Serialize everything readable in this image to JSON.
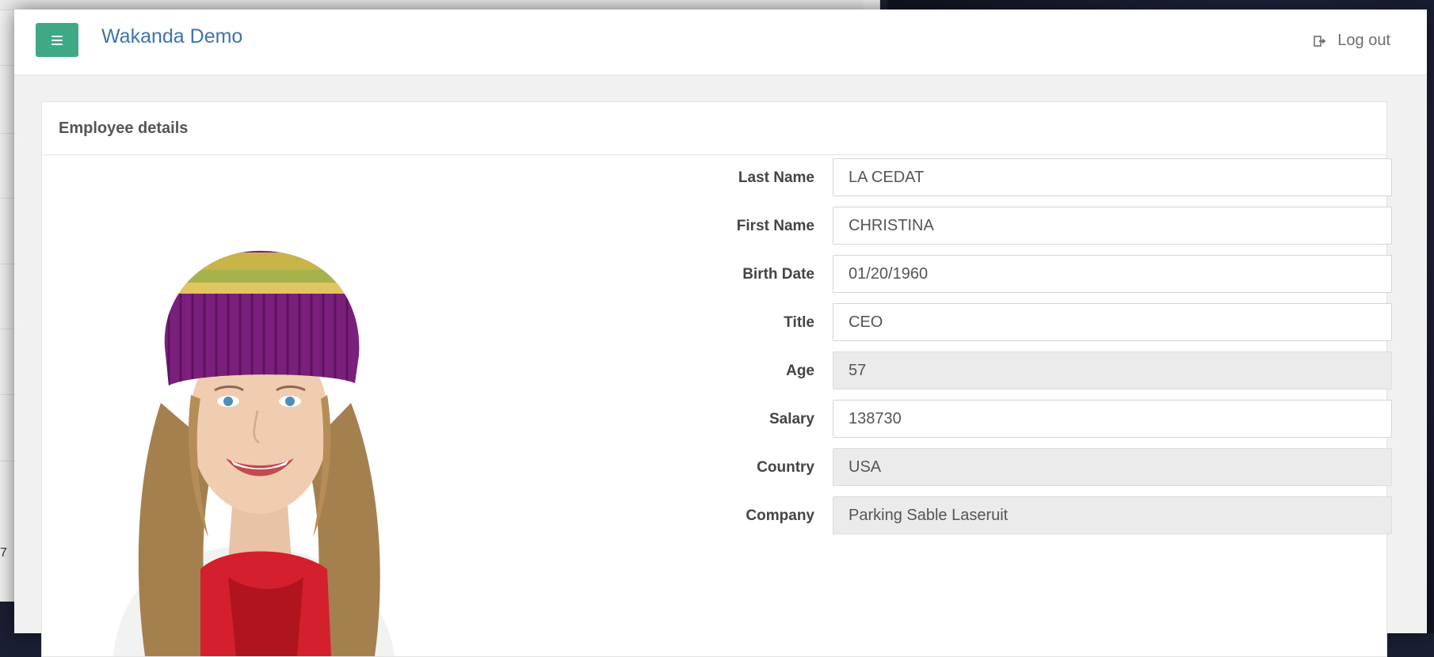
{
  "app": {
    "brand": "Wakanda Demo",
    "logout_label": "Log out",
    "accent_color": "#3fa884",
    "brand_color": "#3e73ad"
  },
  "background": {
    "partial_number": "7"
  },
  "panel": {
    "title": "Employee details"
  },
  "employee": {
    "fields": [
      {
        "label": "Last Name",
        "value": "LA CEDAT",
        "readonly": false
      },
      {
        "label": "First Name",
        "value": "CHRISTINA",
        "readonly": false
      },
      {
        "label": "Birth Date",
        "value": "01/20/1960",
        "readonly": false
      },
      {
        "label": "Title",
        "value": "CEO",
        "readonly": false
      },
      {
        "label": "Age",
        "value": "57",
        "readonly": true
      },
      {
        "label": "Salary",
        "value": "138730",
        "readonly": false
      },
      {
        "label": "Country",
        "value": "USA",
        "readonly": true
      },
      {
        "label": "Company",
        "value": "Parking Sable Laseruit",
        "readonly": true
      }
    ]
  },
  "icons": {
    "menu": "hamburger-icon",
    "logout": "sign-out-icon"
  }
}
